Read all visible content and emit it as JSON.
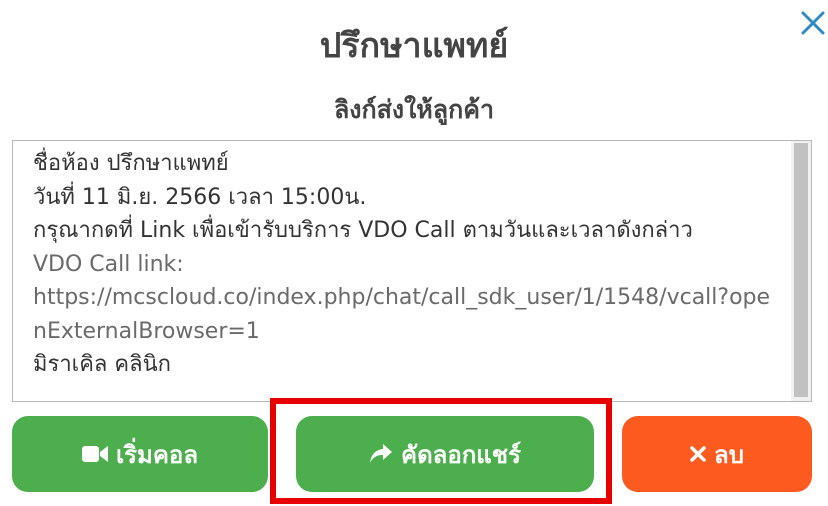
{
  "dialog": {
    "title": "ปรึกษาแพทย์",
    "subtitle": "ลิงก์ส่งให้ลูกค้า",
    "close_icon": "close-icon"
  },
  "message": {
    "room_line": "ชื่อห้อง ปรึกษาแพทย์",
    "date_line": "วันที่ 11 มิ.ย. 2566 เวลา 15:00น.",
    "instruction_line": "กรุณากดที่ Link เพื่อเข้ารับบริการ VDO Call ตามวันและเวลาดังกล่าว",
    "link_label": "VDO Call link:",
    "link_url": "https://mcscloud.co/index.php/chat/call_sdk_user/1/1548/vcall?openExternalBrowser=1",
    "clinic_line": "มิราเคิล คลินิก"
  },
  "buttons": {
    "start_call": {
      "label": "เริ่มคอล",
      "icon": "video-camera-icon"
    },
    "copy_share": {
      "label": "คัดลอกแชร์",
      "icon": "share-arrow-icon"
    },
    "delete": {
      "label": "ลบ",
      "icon": "close-icon"
    }
  },
  "colors": {
    "green": "#4cae4c",
    "orange": "#fd5a1f",
    "close": "#2f8ac4",
    "highlight": "#e60000"
  }
}
